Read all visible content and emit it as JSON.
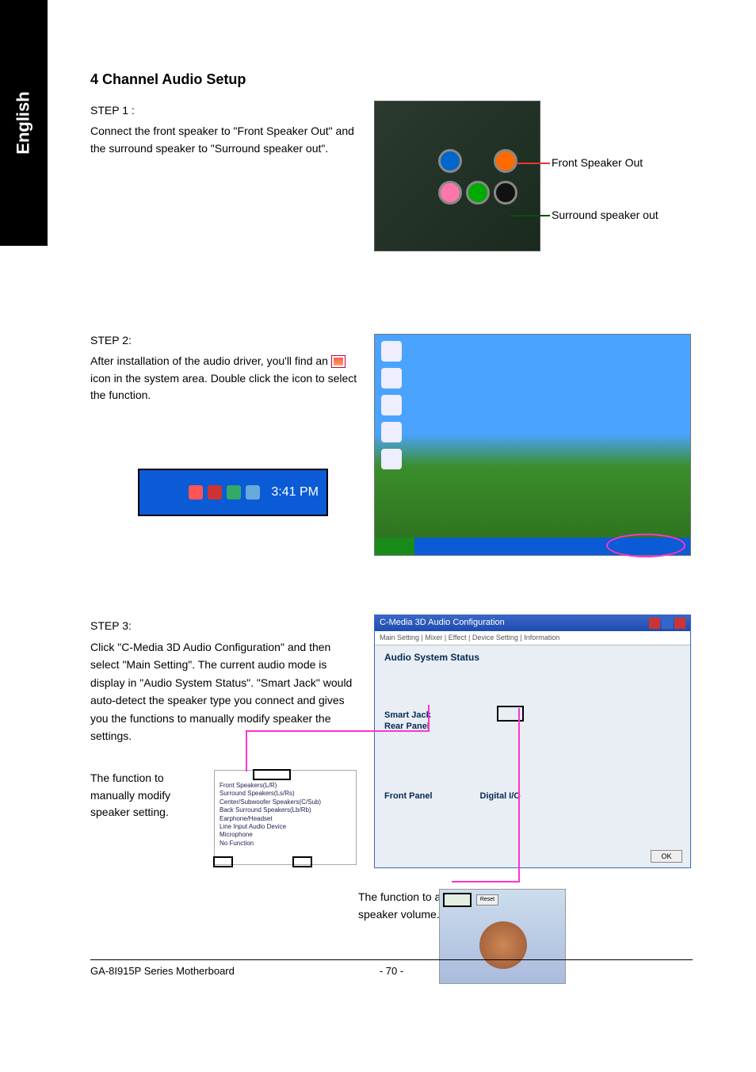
{
  "side_tab": "English",
  "title": "4 Channel Audio Setup",
  "step1": {
    "label": "STEP 1 :",
    "text": "Connect the front speaker to \"Front Speaker Out\" and the surround speaker to \"Surround speaker out\".",
    "out1": "Front Speaker Out",
    "out2": "Surround speaker out"
  },
  "step2": {
    "label": "STEP 2:",
    "text_a": "After installation of the audio driver, you'll find an ",
    "text_b": " icon in the system area.  Double click the icon to select the function.",
    "clock": "3:41 PM"
  },
  "step3": {
    "label": "STEP 3:",
    "text": "Click \"C-Media 3D Audio Configuration\" and then select \"Main Setting\". The current audio mode is display in \"Audio System Status\". \"Smart Jack\" would auto-detect the speaker type you connect and gives you the functions to manually modify speaker the settings.",
    "fn_manual": "The function to manually modify speaker setting.",
    "fn_volume": "The function to adjust speaker volume.",
    "small_panel_items": [
      "Front Speakers(L/R)",
      "Surround Speakers(Ls/Rs)",
      "Center/Subwoofer Speakers(C/Sub)",
      "Back Surround Speakers(Lb/Rb)",
      "Earphone/Headset",
      "Line Input Audio Device",
      "Microphone",
      "No Function"
    ],
    "panel": {
      "title": "C-Media 3D Audio Configuration",
      "tabs": "Main Setting | Mixer | Effect | Device Setting | Information",
      "status": "Audio System Status",
      "smart_jack": "Smart Jack",
      "rear_panel": "Rear Panel",
      "front_panel": "Front Panel",
      "digital_io": "Digital I/O",
      "ok": "OK",
      "reset": "Reset"
    }
  },
  "footer": {
    "left": "GA-8I915P Series Motherboard",
    "center": "- 70 -"
  }
}
